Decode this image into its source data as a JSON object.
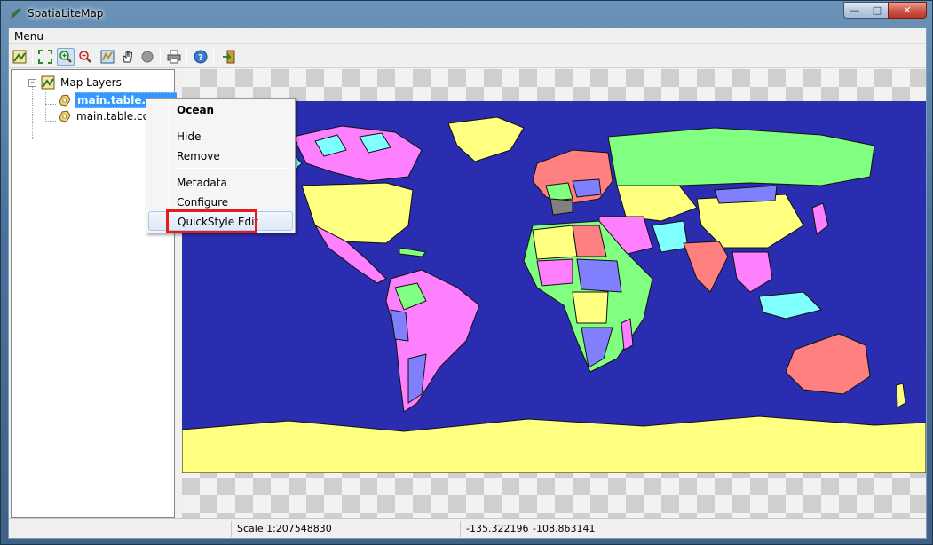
{
  "window": {
    "title": "SpatiaLiteMap",
    "minimize_icon": "minimize-icon",
    "maximize_icon": "maximize-icon",
    "close_icon": "close-icon"
  },
  "menubar": {
    "menu_label": "Menu"
  },
  "toolbar": {
    "buttons": [
      "layer-icon",
      "zoom-extent-icon",
      "zoom-in-icon",
      "zoom-out-icon",
      "map-icon",
      "pan-hand-icon",
      "identify-icon",
      "print-icon",
      "help-icon",
      "exit-icon"
    ],
    "active_button": "zoom-in-icon"
  },
  "tree": {
    "root_label": "Map Layers",
    "layers": [
      {
        "label": "main.table.ocean",
        "selected": true
      },
      {
        "label": "main.table.cour",
        "selected": false
      }
    ]
  },
  "context_menu": {
    "title": "Ocean",
    "items": [
      "Hide",
      "Remove",
      "Metadata",
      "Configure",
      "QuickStyle Edit"
    ],
    "hovered": "QuickStyle Edit"
  },
  "statusbar": {
    "scale": "Scale 1:207548830",
    "x": "-135.322196",
    "y": "-108.863141"
  },
  "colors": {
    "ocean": "#2b2db0",
    "highlight": "#e81a1a",
    "selection": "#3399ff"
  }
}
